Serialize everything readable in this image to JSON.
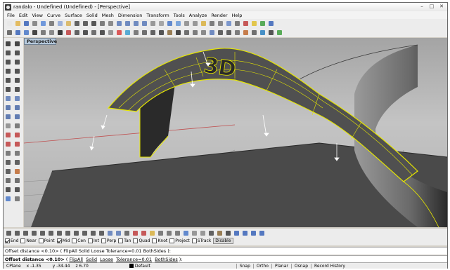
{
  "window": {
    "title": "randalo - Undefined (Undefined) - [Perspective]",
    "minimize": "–",
    "maximize": "□",
    "close": "✕"
  },
  "menu": [
    "File",
    "Edit",
    "View",
    "Curve",
    "Surface",
    "Solid",
    "Mesh",
    "Dimension",
    "Transform",
    "Tools",
    "Analyze",
    "Render",
    "Help"
  ],
  "toolbar1_icons": [
    {
      "name": "new-icon",
      "color": "#e8e8e8"
    },
    {
      "name": "open-icon",
      "color": "#e2b44a"
    },
    {
      "name": "save-icon",
      "color": "#3a64b8"
    },
    {
      "name": "print-icon",
      "color": "#7a7a7a"
    },
    {
      "name": "import-icon",
      "color": "#5a8ad8"
    },
    {
      "name": "cut-icon",
      "color": "#6f6f6f"
    },
    {
      "name": "copy-icon",
      "color": "#8fa8d8"
    },
    {
      "name": "paste-icon",
      "color": "#d8b45a"
    },
    {
      "name": "undo-icon",
      "color": "#4a4a4a"
    },
    {
      "name": "redo-icon",
      "color": "#4a4a4a"
    },
    {
      "name": "pan-icon",
      "color": "#3c3c3c"
    },
    {
      "name": "rotate-view-icon",
      "color": "#6a6a6a"
    },
    {
      "name": "zoom-icon",
      "color": "#7a7a7a"
    },
    {
      "name": "zoom-window-icon",
      "color": "#5a7ab8"
    },
    {
      "name": "zoom-extents-icon",
      "color": "#5a7ab8"
    },
    {
      "name": "zoom-selected-icon",
      "color": "#5a7ab8"
    },
    {
      "name": "undo-view-icon",
      "color": "#5a7ab8"
    },
    {
      "name": "four-views-icon",
      "color": "#8a8a8a"
    },
    {
      "name": "wireframe-icon",
      "color": "#9a9a9a"
    },
    {
      "name": "shaded-icon",
      "color": "#4a78c8"
    },
    {
      "name": "rendered-icon",
      "color": "#6a9ad8"
    },
    {
      "name": "select-all-icon",
      "color": "#8a8a8a"
    },
    {
      "name": "select-none-icon",
      "color": "#8a8a8a"
    },
    {
      "name": "lock-icon",
      "color": "#d8b040"
    },
    {
      "name": "layer-icon",
      "color": "#6a6a6a"
    },
    {
      "name": "properties-icon",
      "color": "#7a7a7a"
    },
    {
      "name": "grid-icon",
      "color": "#6a8ac8"
    },
    {
      "name": "ortho-icon",
      "color": "#6a6a6a"
    },
    {
      "name": "material-icon",
      "color": "#c04040"
    },
    {
      "name": "light-icon",
      "color": "#e0c030"
    },
    {
      "name": "render-icon",
      "color": "#40a040"
    },
    {
      "name": "help-icon",
      "color": "#3a64b8"
    }
  ],
  "toolbar2_icons": [
    {
      "name": "standard-icon",
      "color": "#5a5a5a"
    },
    {
      "name": "cplane-icon",
      "color": "#3a64b8"
    },
    {
      "name": "view-icon",
      "color": "#4a78c8"
    },
    {
      "name": "display-icon",
      "color": "#2a2a2a"
    },
    {
      "name": "select-icon",
      "color": "#6a6a6a"
    },
    {
      "name": "viewport-layout-icon",
      "color": "#7a7a7a"
    },
    {
      "name": "visibility-icon",
      "color": "#1a1a1a"
    },
    {
      "name": "transform-icon",
      "color": "#c04040"
    },
    {
      "name": "curve-tools-icon",
      "color": "#4a4a4a"
    },
    {
      "name": "surface-tools-icon",
      "color": "#3a3a3a"
    },
    {
      "name": "solid-tools-icon",
      "color": "#5a5a5a"
    },
    {
      "name": "mesh-tools-icon",
      "color": "#3a3a3a"
    },
    {
      "name": "render-tools-icon",
      "color": "#8a8a8a"
    },
    {
      "name": "drafting-icon",
      "color": "#d84040"
    },
    {
      "name": "new-in-v5-icon",
      "color": "#40a0d0"
    },
    {
      "name": "loft-icon",
      "color": "#6a6a6a"
    },
    {
      "name": "sweep-icon",
      "color": "#5a5a5a"
    },
    {
      "name": "revolve-icon",
      "color": "#4a4a4a"
    },
    {
      "name": "network-srf-icon",
      "color": "#3a3a3a"
    },
    {
      "name": "patch-icon",
      "color": "#8a6a3a"
    },
    {
      "name": "blend-icon",
      "color": "#2a2a2a"
    },
    {
      "name": "fillet-icon",
      "color": "#5a5a5a"
    },
    {
      "name": "offset-icon",
      "color": "#6a6a6a"
    },
    {
      "name": "extrude-icon",
      "color": "#7a7a7a"
    },
    {
      "name": "boolean-icon",
      "color": "#5a7ab8"
    },
    {
      "name": "trim-icon",
      "color": "#4a4a4a"
    },
    {
      "name": "split-icon",
      "color": "#4a4a4a"
    },
    {
      "name": "join-icon",
      "color": "#6a6a6a"
    },
    {
      "name": "explode-icon",
      "color": "#c06a30"
    },
    {
      "name": "rebuild-icon",
      "color": "#5a5a5a"
    },
    {
      "name": "analyze-icon",
      "color": "#2a80c0"
    },
    {
      "name": "zebra-icon",
      "color": "#3a3a3a"
    },
    {
      "name": "curvature-icon",
      "color": "#40a040"
    }
  ],
  "left_tools": [
    {
      "name": "select-arrow-icon",
      "color": "#2a2a2a"
    },
    {
      "name": "point-icon",
      "color": "#2a2a2a"
    },
    {
      "name": "line-icon",
      "color": "#3a3a3a"
    },
    {
      "name": "polyline-icon",
      "color": "#3a3a3a"
    },
    {
      "name": "curve-icon",
      "color": "#3a3a3a"
    },
    {
      "name": "circle-icon",
      "color": "#3a3a3a"
    },
    {
      "name": "arc-icon",
      "color": "#3a3a3a"
    },
    {
      "name": "ellipse-icon",
      "color": "#3a3a3a"
    },
    {
      "name": "rectangle-icon",
      "color": "#3a3a3a"
    },
    {
      "name": "polygon-icon",
      "color": "#3a3a3a"
    },
    {
      "name": "text-icon",
      "color": "#3a3a3a"
    },
    {
      "name": "fillet-curve-icon",
      "color": "#3a3a3a"
    },
    {
      "name": "plane-srf-icon",
      "color": "#5a7ab8"
    },
    {
      "name": "extrude-srf-icon",
      "color": "#5a7ab8"
    },
    {
      "name": "box-icon",
      "color": "#4a6aa8"
    },
    {
      "name": "sphere-icon",
      "color": "#4a6aa8"
    },
    {
      "name": "cylinder-icon",
      "color": "#4a6aa8"
    },
    {
      "name": "cone-icon",
      "color": "#4a6aa8"
    },
    {
      "name": "mesh-icon",
      "color": "#8a8a8a"
    },
    {
      "name": "dimension-icon",
      "color": "#6a6a6a"
    },
    {
      "name": "move-icon",
      "color": "#c04040"
    },
    {
      "name": "copy-obj-icon",
      "color": "#c04040"
    },
    {
      "name": "rotate-icon",
      "color": "#c04040"
    },
    {
      "name": "scale-icon",
      "color": "#c04040"
    },
    {
      "name": "mirror-icon",
      "color": "#6a6a6a"
    },
    {
      "name": "array-icon",
      "color": "#6a6a6a"
    },
    {
      "name": "trim-obj-icon",
      "color": "#4a4a4a"
    },
    {
      "name": "split-obj-icon",
      "color": "#4a4a4a"
    },
    {
      "name": "join-obj-icon",
      "color": "#4a4a4a"
    },
    {
      "name": "explode-obj-icon",
      "color": "#c06a30"
    },
    {
      "name": "group-icon",
      "color": "#5a5a5a"
    },
    {
      "name": "ungroup-icon",
      "color": "#5a5a5a"
    },
    {
      "name": "points-on-icon",
      "color": "#3a3a3a"
    },
    {
      "name": "points-off-icon",
      "color": "#3a3a3a"
    },
    {
      "name": "render-view-icon",
      "color": "#4a78c8"
    },
    {
      "name": "options-icon",
      "color": "#6a6a6a"
    }
  ],
  "viewport": {
    "label": "Perspective",
    "surface_text": "3D"
  },
  "osnap_icons": [
    {
      "name": "osnap-end-icon",
      "color": "#4a4a4a"
    },
    {
      "name": "osnap-near-icon",
      "color": "#4a4a4a"
    },
    {
      "name": "osnap-point-icon",
      "color": "#4a4a4a"
    },
    {
      "name": "osnap-mid-icon",
      "color": "#4a4a4a"
    },
    {
      "name": "osnap-cen-icon",
      "color": "#4a4a4a"
    },
    {
      "name": "osnap-int-icon",
      "color": "#4a4a4a"
    },
    {
      "name": "osnap-perp-icon",
      "color": "#4a4a4a"
    },
    {
      "name": "osnap-tan-icon",
      "color": "#4a4a4a"
    },
    {
      "name": "osnap-quad-icon",
      "color": "#4a4a4a"
    },
    {
      "name": "osnap-knot-icon",
      "color": "#4a4a4a"
    },
    {
      "name": "osnap-project-icon",
      "color": "#4a4a4a"
    },
    {
      "name": "osnap-strack-icon",
      "color": "#4a4a4a"
    },
    {
      "name": "history-icon",
      "color": "#5a7ab8"
    },
    {
      "name": "layers-icon",
      "color": "#5a7ab8"
    },
    {
      "name": "filter-icon",
      "color": "#5a5a5a"
    },
    {
      "name": "gumball-icon",
      "color": "#c04040"
    },
    {
      "name": "record-icon",
      "color": "#c04040"
    },
    {
      "name": "lock-osnap-icon",
      "color": "#d8b040"
    },
    {
      "name": "hide-icon",
      "color": "#6a6a6a"
    },
    {
      "name": "show-icon",
      "color": "#6a6a6a"
    },
    {
      "name": "isolate-icon",
      "color": "#6a6a6a"
    },
    {
      "name": "shade-icon",
      "color": "#4a78c8"
    },
    {
      "name": "ghost-icon",
      "color": "#8a8a8a"
    },
    {
      "name": "xray-icon",
      "color": "#8a8a8a"
    },
    {
      "name": "technical-icon",
      "color": "#4a4a4a"
    },
    {
      "name": "artistic-icon",
      "color": "#8a6a3a"
    },
    {
      "name": "pen-icon",
      "color": "#3a3a3a"
    },
    {
      "name": "cplane-world-icon",
      "color": "#3a64b8"
    },
    {
      "name": "cplane-top-icon",
      "color": "#3a64b8"
    },
    {
      "name": "cplane-front-icon",
      "color": "#3a64b8"
    },
    {
      "name": "cplane-right-icon",
      "color": "#3a64b8"
    }
  ],
  "osnap_options": [
    {
      "label": "End",
      "checked": true
    },
    {
      "label": "Near",
      "checked": false
    },
    {
      "label": "Point",
      "checked": false
    },
    {
      "label": "Mid",
      "checked": true
    },
    {
      "label": "Cen",
      "checked": false
    },
    {
      "label": "Int",
      "checked": false
    },
    {
      "label": "Perp",
      "checked": false
    },
    {
      "label": "Tan",
      "checked": false
    },
    {
      "label": "Quad",
      "checked": false
    },
    {
      "label": "Knot",
      "checked": false
    },
    {
      "label": "Project",
      "checked": false
    },
    {
      "label": "STrack",
      "checked": false
    }
  ],
  "osnap_disable": "Disable",
  "command": {
    "history": "Offset distance <0.10> ( FlipAll  Solid  Loose  Tolerance=0.01  BothSides ):",
    "prompt_label": "Offset distance <0.10>",
    "prompt_open": " ( ",
    "opt1": "FlipAll",
    "opt2": "Solid",
    "opt3": "Loose",
    "opt4": "Tolerance=0.01",
    "opt5": "BothSides",
    "prompt_close": " ):"
  },
  "status": {
    "cplane": "CPlane",
    "x": "x -1.35",
    "y": "y -34.44",
    "z": "z 6.70",
    "layer": "Default",
    "layer_color": "#000000",
    "snap": "Snap",
    "ortho": "Ortho",
    "planar": "Planar",
    "osnap": "Osnap",
    "record_history": "Record History"
  }
}
